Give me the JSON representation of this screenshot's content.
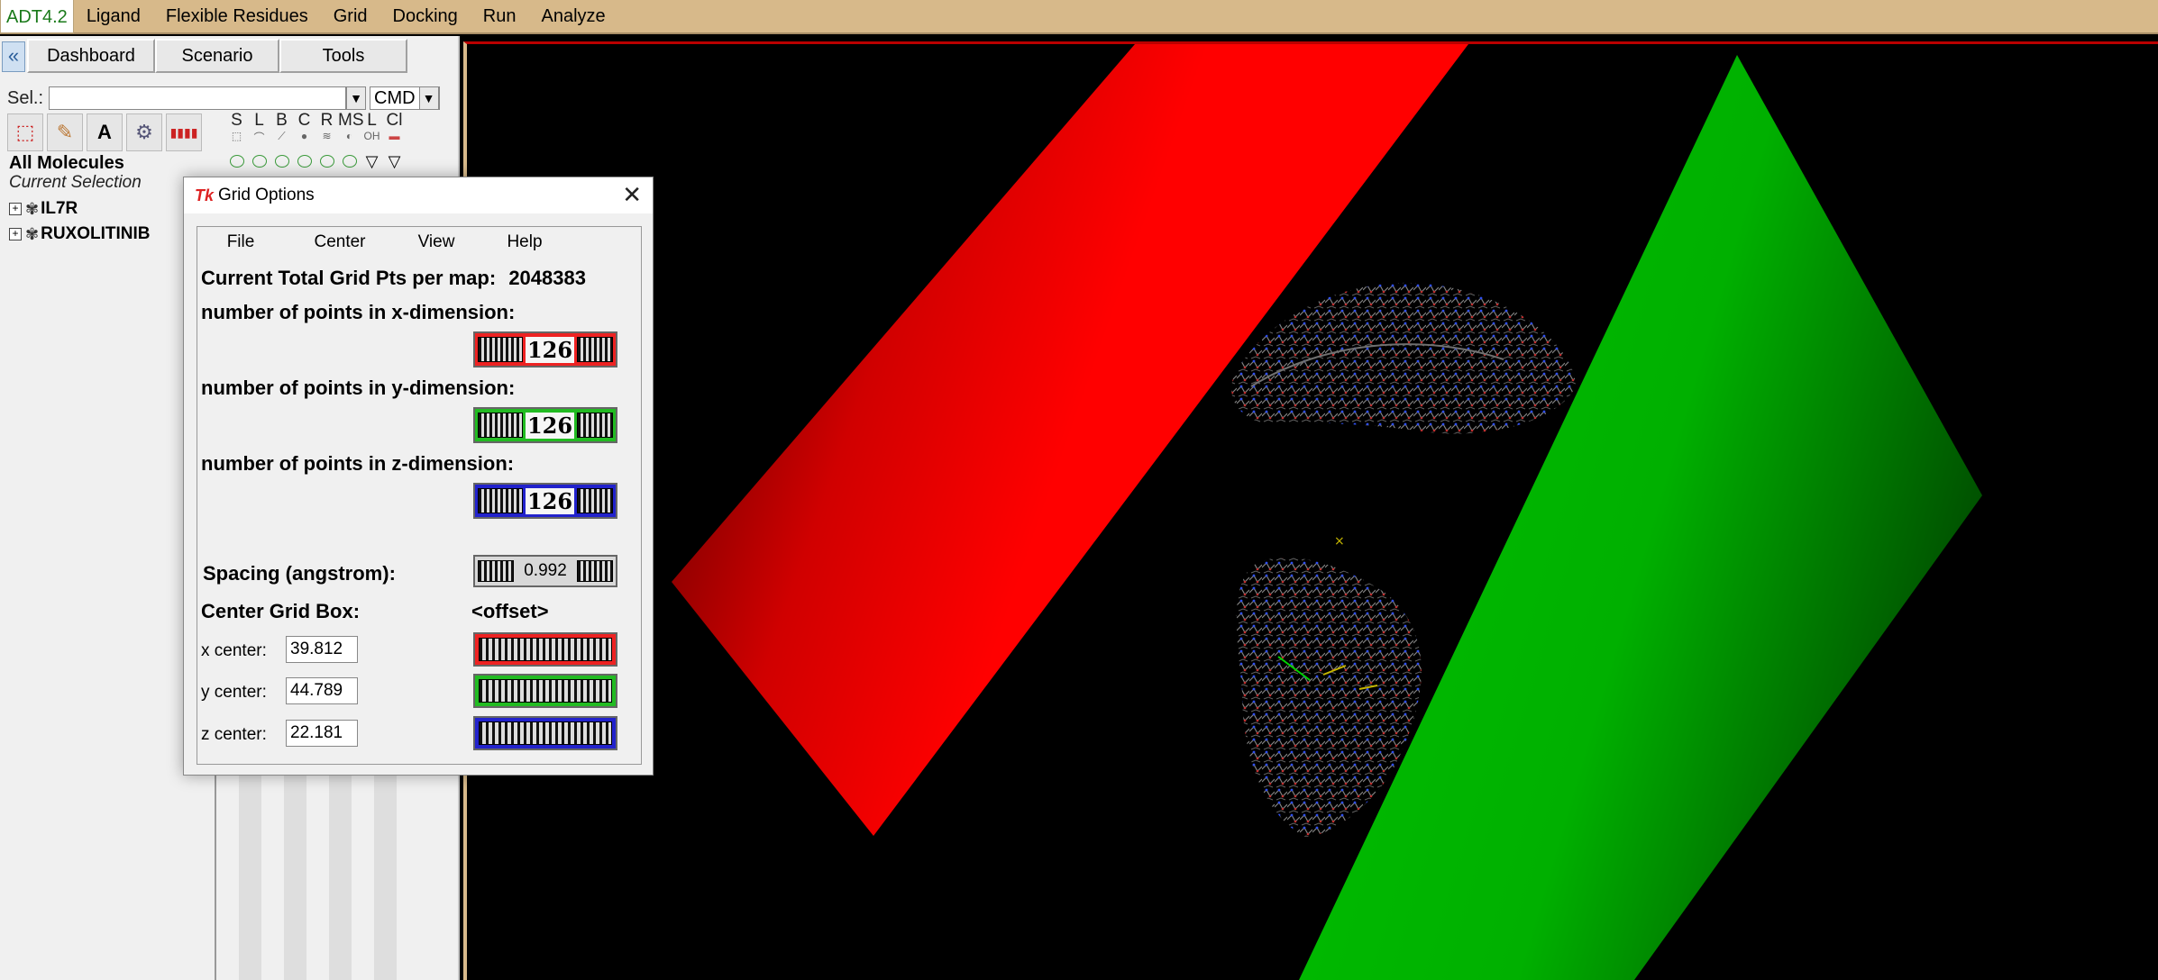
{
  "menubar": {
    "items": [
      "ADT4.2",
      "Ligand",
      "Flexible Residues",
      "Grid",
      "Docking",
      "Run",
      "Analyze"
    ]
  },
  "left_panel": {
    "tabs": [
      "Dashboard",
      "Scenario",
      "Tools"
    ],
    "sel_label": "Sel.:",
    "sel_value": "",
    "cmd_label": "CMD",
    "column_headers": [
      "S",
      "L",
      "B",
      "C",
      "R",
      "MS",
      "L",
      "Cl"
    ],
    "column_subicons": [
      "",
      "",
      "",
      "",
      "",
      "",
      "OH",
      ""
    ],
    "tree": {
      "all_molecules": "All Molecules",
      "current_selection": "Current Selection",
      "nodes": [
        "IL7R",
        "RUXOLITINIB"
      ]
    }
  },
  "dialog": {
    "title": "Grid Options",
    "menu": [
      "File",
      "Center",
      "View",
      "Help"
    ],
    "total_points_label": "Current Total Grid Pts per map:",
    "total_points_value": "2048383",
    "x_dim_label": "number of points in x-dimension:",
    "x_dim_value": "126",
    "y_dim_label": "number of points in y-dimension:",
    "y_dim_value": "126",
    "z_dim_label": "number of points in z-dimension:",
    "z_dim_value": "126",
    "spacing_label": "Spacing (angstrom):",
    "spacing_value": "0.992",
    "center_label": "Center Grid Box:",
    "offset_label": "<offset>",
    "x_center_label": "x center:",
    "x_center_value": "39.812",
    "y_center_label": "y center:",
    "y_center_value": "44.789",
    "z_center_label": "z center:",
    "z_center_value": "22.181"
  },
  "colors": {
    "menubar_bg": "#d7b98a",
    "x_axis": "#e22222",
    "y_axis": "#22bb22",
    "z_axis": "#2222cc",
    "viewer_bg": "#000000"
  }
}
